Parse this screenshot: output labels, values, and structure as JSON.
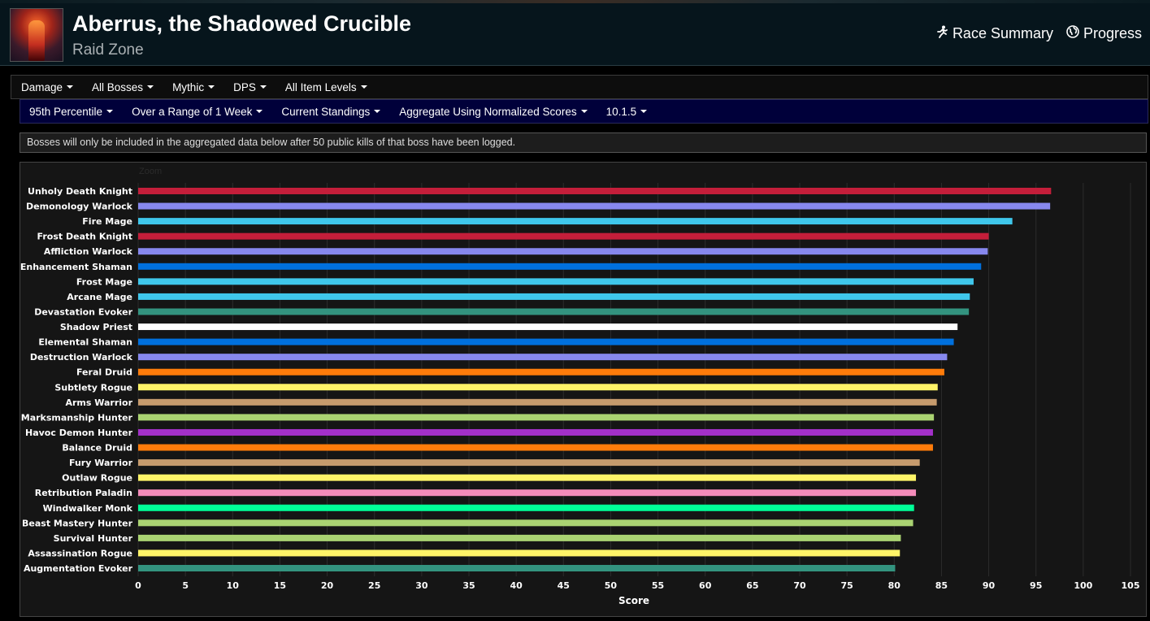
{
  "header": {
    "title": "Aberrus, the Shadowed Crucible",
    "subtitle": "Raid Zone",
    "links": [
      {
        "label": "Race Summary",
        "icon": "runner-icon"
      },
      {
        "label": "Progress",
        "icon": "globe-icon"
      }
    ]
  },
  "filters_primary": [
    "Damage",
    "All Bosses",
    "Mythic",
    "DPS",
    "All Item Levels"
  ],
  "filters_secondary": [
    "95th Percentile",
    "Over a Range of 1 Week",
    "Current Standings",
    "Aggregate Using Normalized Scores",
    "10.1.5"
  ],
  "notice": "Bosses will only be included in the aggregated data below after 50 public kills of that boss have been logged.",
  "zoom_label": "Zoom",
  "chart_data": {
    "type": "bar",
    "orientation": "horizontal",
    "xlabel": "Score",
    "xlim": [
      0,
      105
    ],
    "xticks": [
      0,
      5,
      10,
      15,
      20,
      25,
      30,
      35,
      40,
      45,
      50,
      55,
      60,
      65,
      70,
      75,
      80,
      85,
      90,
      95,
      100,
      105
    ],
    "grid": true,
    "categories": [
      "Unholy Death Knight",
      "Demonology Warlock",
      "Fire Mage",
      "Frost Death Knight",
      "Affliction Warlock",
      "Enhancement Shaman",
      "Frost Mage",
      "Arcane Mage",
      "Devastation Evoker",
      "Shadow Priest",
      "Elemental Shaman",
      "Destruction Warlock",
      "Feral Druid",
      "Subtlety Rogue",
      "Arms Warrior",
      "Marksmanship Hunter",
      "Havoc Demon Hunter",
      "Balance Druid",
      "Fury Warrior",
      "Outlaw Rogue",
      "Retribution Paladin",
      "Windwalker Monk",
      "Beast Mastery Hunter",
      "Survival Hunter",
      "Assassination Rogue",
      "Augmentation Evoker"
    ],
    "values": [
      96.6,
      96.5,
      92.5,
      90.0,
      89.9,
      89.2,
      88.4,
      88.0,
      87.9,
      86.7,
      86.3,
      85.6,
      85.3,
      84.6,
      84.5,
      84.2,
      84.1,
      84.1,
      82.7,
      82.3,
      82.3,
      82.1,
      82.0,
      80.7,
      80.6,
      80.1
    ],
    "colors": [
      "#C41E3A",
      "#8788EE",
      "#3FC7EB",
      "#C41E3A",
      "#8788EE",
      "#0070DD",
      "#3FC7EB",
      "#3FC7EB",
      "#33937F",
      "#FFFFFF",
      "#0070DD",
      "#8788EE",
      "#FF7C0A",
      "#FFF468",
      "#C69B6D",
      "#AAD372",
      "#A330C9",
      "#FF7C0A",
      "#C69B6D",
      "#FFF468",
      "#F48CBA",
      "#00FF98",
      "#AAD372",
      "#AAD372",
      "#FFF468",
      "#33937F"
    ]
  }
}
